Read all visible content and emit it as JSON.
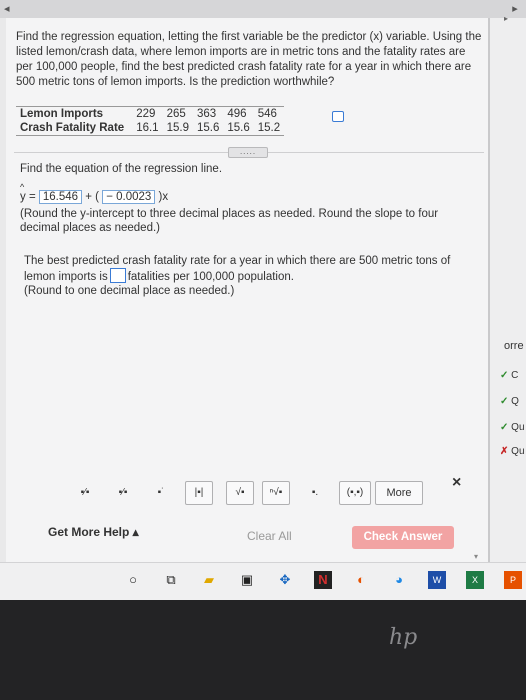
{
  "question": "Find the regression equation, letting the first variable be the predictor (x) variable. Using the listed lemon/crash data, where lemon imports are in metric tons and the fatality rates are per 100,000 people, find the best predicted crash fatality rate for a year in which there are 500 metric tons of lemon imports. Is the prediction worthwhile?",
  "table": {
    "rows": [
      {
        "label": "Lemon Imports",
        "values": [
          "229",
          "265",
          "363",
          "496",
          "546"
        ]
      },
      {
        "label": "Crash Fatality Rate",
        "values": [
          "16.1",
          "15.9",
          "15.6",
          "15.6",
          "15.2"
        ]
      }
    ]
  },
  "more_dots": ".....",
  "find_equation": "Find the equation of the regression line.",
  "equation": {
    "yhat": "y",
    "eq_sign": "=",
    "intercept": "16.546",
    "plus_open": "+ (",
    "slope": "− 0.0023",
    "close_x": ")x"
  },
  "rounding_note": "(Round the y-intercept to three decimal places as needed. Round the slope to four decimal places as needed.)",
  "prediction": {
    "text_before": "The best predicted crash fatality rate for a year in which there are 500 metric tons of lemon imports is",
    "text_after": "fatalities per 100,000 population.",
    "rounding": "(Round to one decimal place as needed.)"
  },
  "toolbar": {
    "tools": [
      "fraction-icon",
      "mixed-number-icon",
      "exponent-icon",
      "absolute-value-icon",
      "sqrt-icon",
      "nth-root-icon",
      "decimal-icon",
      "interval-icon"
    ],
    "tool_glyphs": [
      "▪⁄▪",
      "▪⁄▪",
      "▪˙",
      "|▪|",
      "√▪",
      "ⁿ√▪",
      "▪.",
      "(▪,▪)"
    ],
    "more": "More",
    "close": "×"
  },
  "footer": {
    "help": "Get More Help ▴",
    "clear_all": "Clear All",
    "check_answer": "Check Answer"
  },
  "sidebar": {
    "header": "orre",
    "items": [
      {
        "mark": "✓",
        "text": "C",
        "status": "correct"
      },
      {
        "mark": "✓",
        "text": "Q",
        "status": "correct"
      },
      {
        "mark": "✓",
        "text": "Qu",
        "status": "correct"
      },
      {
        "mark": "✗",
        "text": "Qu",
        "status": "incorrect"
      }
    ]
  },
  "colors": {
    "check_button": "#f2a3a3",
    "answer_border": "#7aa7d8",
    "correct": "#2e8b2e",
    "incorrect": "#c62828"
  }
}
